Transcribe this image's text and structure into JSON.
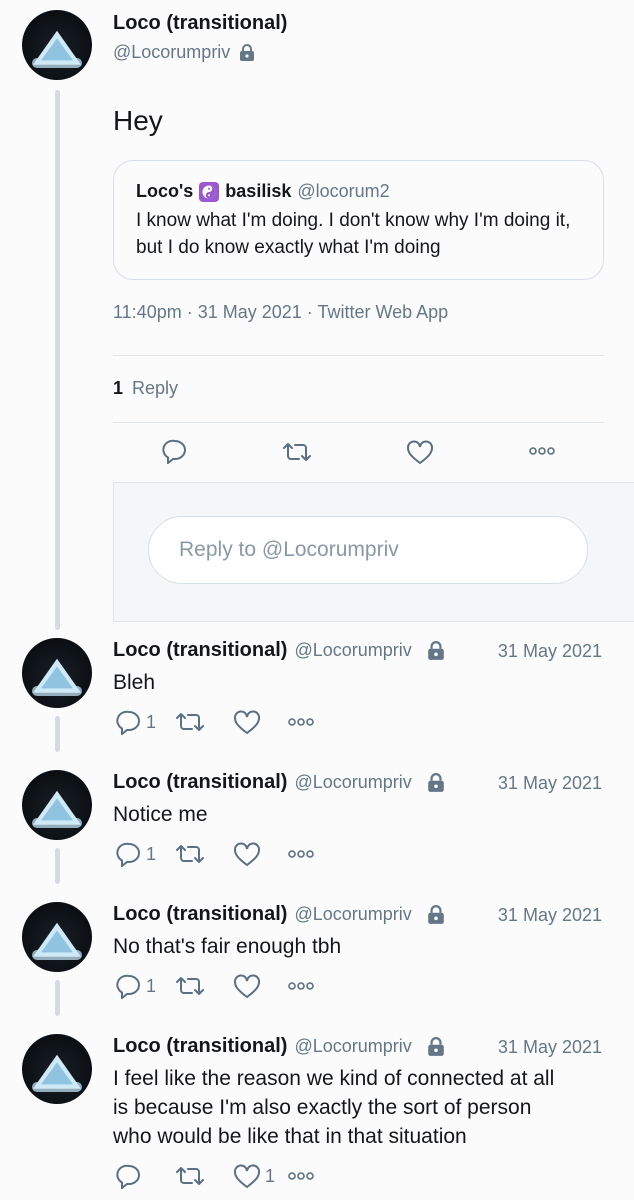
{
  "main_tweet": {
    "display_name": "Loco (transitional)",
    "handle": "@Locorumpriv",
    "text": "Hey",
    "quote": {
      "display_name_part1": "Loco's",
      "display_name_part2": "basilisk",
      "handle": "@locorum2",
      "text": "I know what I'm doing. I don't know why I'm doing it, but I do know exactly what I'm doing"
    },
    "meta": "11:40pm · 31 May 2021 · Twitter Web App",
    "reply_count": "1",
    "reply_label": "Reply",
    "reply_placeholder": "Reply to @Locorumpriv"
  },
  "replies": [
    {
      "display_name": "Loco (transitional)",
      "handle": "@Locorumpriv",
      "date": "31 May 2021",
      "text": "Bleh",
      "reply_count": "1",
      "like_count": ""
    },
    {
      "display_name": "Loco (transitional)",
      "handle": "@Locorumpriv",
      "date": "31 May 2021",
      "text": "Notice me",
      "reply_count": "1",
      "like_count": ""
    },
    {
      "display_name": "Loco (transitional)",
      "handle": "@Locorumpriv",
      "date": "31 May 2021",
      "text": "No that's fair enough tbh",
      "reply_count": "1",
      "like_count": ""
    },
    {
      "display_name": "Loco (transitional)",
      "handle": "@Locorumpriv",
      "date": "31 May 2021",
      "text_lines": [
        "I feel like the reason we kind of connected at all",
        "is because I'm also exactly the sort of person",
        "who would be like that in that situation"
      ],
      "reply_count": "",
      "like_count": "1"
    }
  ],
  "icons": {
    "reply": "reply-icon",
    "retweet": "retweet-icon",
    "like": "heart-icon",
    "more": "more-icon",
    "lock": "lock-icon",
    "yin_yang": "yin-yang-icon"
  },
  "colors": {
    "text": "#14171a",
    "secondary": "#657786",
    "icon": "#5b7083",
    "yin_yang_bg": "#9b59d0"
  }
}
